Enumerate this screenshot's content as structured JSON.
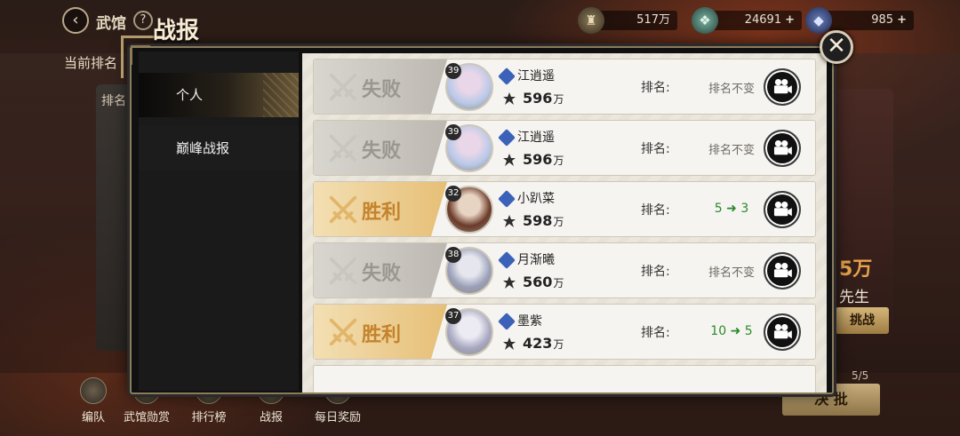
{
  "topbar": {
    "title": "武馆",
    "help": "?",
    "resources": [
      {
        "icon": "crest-icon",
        "value": "517万"
      },
      {
        "icon": "jade-icon",
        "value": "24691",
        "plus": "+"
      },
      {
        "icon": "crystal-icon",
        "value": "985",
        "plus": "+"
      }
    ]
  },
  "background": {
    "rank_label": "当前排名",
    "left_card_label": "排名",
    "right_power": "5万",
    "right_name": "先生",
    "challenge": "挑战",
    "page_indicator": "5/5",
    "bottom_button": "决 批",
    "nav": [
      {
        "label": "编队"
      },
      {
        "label": "武馆勋赏"
      },
      {
        "label": "排行榜"
      },
      {
        "label": "战报"
      },
      {
        "label": "每日奖励"
      }
    ]
  },
  "modal": {
    "title": "战报",
    "close": "✕",
    "menu": [
      {
        "label": "个人",
        "active": true
      },
      {
        "label": "巅峰战报",
        "active": false
      }
    ],
    "rank_label": "排名:",
    "records": [
      {
        "result": "失败",
        "type": "lose",
        "level": "39",
        "name": "江逍遥",
        "power": "596",
        "unit": "万",
        "rank_text": "排名不变",
        "rank_from": "",
        "rank_to": ""
      },
      {
        "result": "失败",
        "type": "lose",
        "level": "39",
        "name": "江逍遥",
        "power": "596",
        "unit": "万",
        "rank_text": "排名不变",
        "rank_from": "",
        "rank_to": ""
      },
      {
        "result": "胜利",
        "type": "win",
        "level": "32",
        "name": "小趴菜",
        "power": "598",
        "unit": "万",
        "rank_text": "",
        "rank_from": "5",
        "rank_to": "3"
      },
      {
        "result": "失败",
        "type": "lose",
        "level": "38",
        "name": "月渐曦",
        "power": "560",
        "unit": "万",
        "rank_text": "排名不变",
        "rank_from": "",
        "rank_to": ""
      },
      {
        "result": "胜利",
        "type": "win",
        "level": "37",
        "name": "墨紫",
        "power": "423",
        "unit": "万",
        "rank_text": "",
        "rank_from": "10",
        "rank_to": "5"
      }
    ]
  },
  "colors": {
    "win": "#c4832c",
    "lose": "#9a9690",
    "rank_up": "#2a8a2a",
    "frame": "#8c7a5a"
  }
}
